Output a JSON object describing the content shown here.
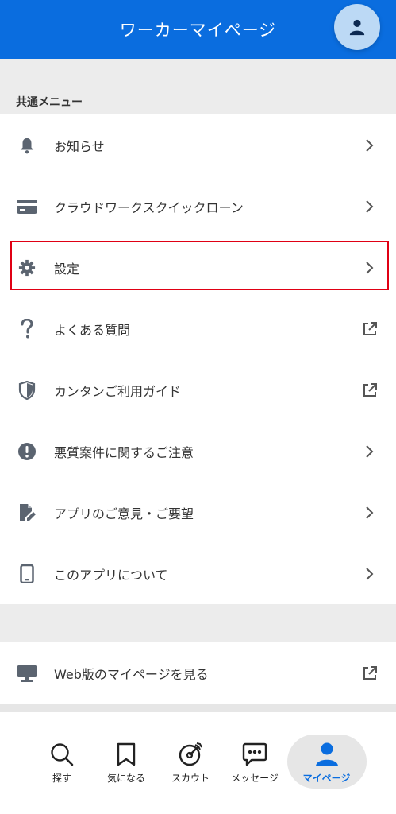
{
  "header": {
    "title": "ワーカーマイページ"
  },
  "section": {
    "label": "共通メニュー"
  },
  "menu": [
    {
      "label": "お知らせ",
      "icon": "bell-icon",
      "right": "chevron"
    },
    {
      "label": "クラウドワークスクイックローン",
      "icon": "credit-card-icon",
      "right": "chevron"
    },
    {
      "label": "設定",
      "icon": "gear-icon",
      "right": "chevron",
      "highlighted": true
    },
    {
      "label": "よくある質問",
      "icon": "question-icon",
      "right": "external"
    },
    {
      "label": "カンタンご利用ガイド",
      "icon": "shield-icon",
      "right": "external"
    },
    {
      "label": "悪質案件に関するご注意",
      "icon": "exclamation-icon",
      "right": "chevron"
    },
    {
      "label": "アプリのご意見・ご要望",
      "icon": "document-edit-icon",
      "right": "chevron"
    },
    {
      "label": "このアプリについて",
      "icon": "phone-icon",
      "right": "chevron"
    }
  ],
  "menu2": [
    {
      "label": "Web版のマイページを見る",
      "icon": "monitor-icon",
      "right": "external"
    }
  ],
  "tabs": [
    {
      "label": "探す",
      "icon": "search-icon"
    },
    {
      "label": "気になる",
      "icon": "bookmark-icon"
    },
    {
      "label": "スカウト",
      "icon": "target-icon"
    },
    {
      "label": "メッセージ",
      "icon": "chat-icon"
    },
    {
      "label": "マイページ",
      "icon": "person-icon",
      "active": true
    }
  ],
  "colors": {
    "brand": "#0a6ddf",
    "highlight": "#e00014",
    "icon": "#5b6470"
  }
}
